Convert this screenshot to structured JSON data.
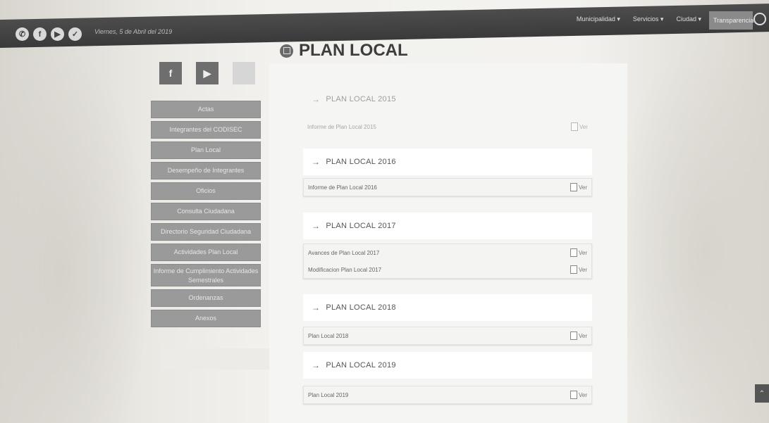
{
  "topbar": {
    "date": "Viernes, 5 de Abril del 2019",
    "social_icons": [
      "whatsapp-icon",
      "facebook-icon",
      "youtube-icon",
      "twitter-icon"
    ],
    "social_glyphs": [
      "✆",
      "f",
      "▶",
      "✓"
    ],
    "nav": [
      "Municipalidad ▾",
      "Servicios ▾",
      "Ciudad ▾"
    ],
    "transparencia": "Transparencia",
    "search_icon": "search-icon"
  },
  "page": {
    "title": "PLAN LOCAL"
  },
  "side_social": {
    "facebook_glyph": "f",
    "youtube_glyph": "▶"
  },
  "side_menu": [
    "Actas",
    "Integrantes del CODISEC",
    "Plan Local",
    "Desempeño de Integrantes",
    "Oficios",
    "Consulta Ciudadana",
    "Directorio Seguridad Ciudadana",
    "Actividades Plan Local",
    "Informe de Cumplimiento Actividades Semestrales",
    "Ordenanzas",
    "Anexos"
  ],
  "sections": [
    {
      "title": "PLAN LOCAL 2015",
      "rows": [
        {
          "label": "Informe de Plan Local 2015",
          "action": "Ver"
        }
      ]
    },
    {
      "title": "PLAN LOCAL 2016",
      "rows": [
        {
          "label": "Informe de Plan Local 2016",
          "action": "Ver"
        }
      ]
    },
    {
      "title": "PLAN LOCAL 2017",
      "rows": [
        {
          "label": "Avances de Plan Local 2017",
          "action": "Ver"
        },
        {
          "label": "Modificacion Plan Local 2017",
          "action": "Ver"
        }
      ]
    },
    {
      "title": "PLAN LOCAL 2018",
      "rows": [
        {
          "label": "Plan Local 2018",
          "action": "Ver"
        }
      ]
    },
    {
      "title": "PLAN LOCAL 2019",
      "rows": [
        {
          "label": "Plan Local 2019",
          "action": "Ver"
        }
      ]
    }
  ],
  "scroll_top_glyph": "⌃"
}
